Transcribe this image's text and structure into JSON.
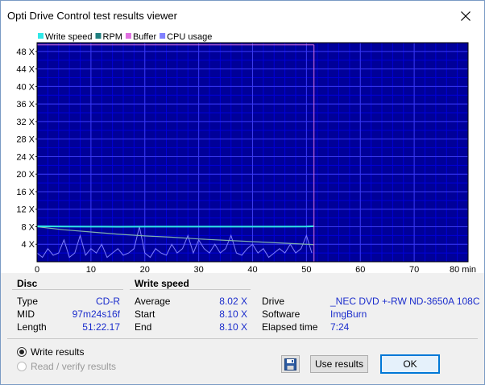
{
  "window": {
    "title": "Opti Drive Control test results viewer"
  },
  "colors": {
    "plot_bg": "#000099",
    "grid": "#0000d8",
    "write_speed": "#30e8e8",
    "rpm": "#208080",
    "buffer": "#e070e0",
    "cpu_usage": "#8080ff"
  },
  "chart_data": {
    "type": "line",
    "legend": [
      "Write speed",
      "RPM",
      "Buffer",
      "CPU usage"
    ],
    "legend_position": "top-left",
    "x_ticks": [
      "0",
      "10",
      "20",
      "30",
      "40",
      "50",
      "60",
      "70",
      "80 min"
    ],
    "y_ticks": [
      "4 X",
      "8 X",
      "12 X",
      "16 X",
      "20 X",
      "24 X",
      "28 X",
      "32 X",
      "36 X",
      "40 X",
      "44 X",
      "48 X"
    ],
    "xlim": [
      0,
      80
    ],
    "ylim": [
      0,
      50
    ],
    "grid": true,
    "series": [
      {
        "name": "Write speed",
        "x": [
          0,
          5,
          10,
          15,
          20,
          25,
          30,
          35,
          40,
          45,
          50,
          51.4
        ],
        "y": [
          8.1,
          8.05,
          8.02,
          8.0,
          8.02,
          8.03,
          8.02,
          8.01,
          8.02,
          8.03,
          8.05,
          8.1
        ]
      },
      {
        "name": "RPM",
        "x": [
          0,
          5,
          10,
          15,
          20,
          25,
          30,
          35,
          40,
          45,
          50,
          51.4
        ],
        "y": [
          8.0,
          7.3,
          6.8,
          6.3,
          5.9,
          5.6,
          5.2,
          4.9,
          4.6,
          4.3,
          4.0,
          3.9
        ]
      },
      {
        "name": "Buffer",
        "x": [
          0,
          51.4
        ],
        "y": [
          49.5,
          49.5
        ]
      },
      {
        "name": "CPU usage",
        "x": [
          0,
          1,
          2,
          3,
          4,
          5,
          6,
          7,
          8,
          9,
          10,
          11,
          12,
          13,
          14,
          15,
          16,
          17,
          18,
          19,
          20,
          21,
          22,
          23,
          24,
          25,
          26,
          27,
          28,
          29,
          30,
          31,
          32,
          33,
          34,
          35,
          36,
          37,
          38,
          39,
          40,
          41,
          42,
          43,
          44,
          45,
          46,
          47,
          48,
          49,
          50,
          51
        ],
        "y": [
          2,
          1,
          3,
          1.5,
          2,
          5,
          1,
          2,
          6,
          1.5,
          3,
          2,
          4,
          1,
          2,
          3,
          1.5,
          2,
          3,
          8,
          2,
          1,
          3,
          2,
          1.5,
          4,
          2,
          3,
          6,
          2,
          5,
          3,
          2,
          4,
          2,
          3,
          6,
          2,
          1.5,
          3,
          4,
          2,
          3,
          1,
          2,
          3,
          2,
          4,
          2,
          3,
          6,
          2
        ]
      }
    ]
  },
  "disc": {
    "heading": "Disc",
    "type_label": "Type",
    "type_value": "CD-R",
    "mid_label": "MID",
    "mid_value": "97m24s16f",
    "length_label": "Length",
    "length_value": "51:22.17"
  },
  "write_speed": {
    "heading": "Write speed",
    "average_label": "Average",
    "average_value": "8.02 X",
    "start_label": "Start",
    "start_value": "8.10 X",
    "end_label": "End",
    "end_value": "8.10 X"
  },
  "drive_info": {
    "drive_label": "Drive",
    "drive_value": "_NEC DVD +-RW ND-3650A 108C",
    "software_label": "Software",
    "software_value": "ImgBurn",
    "elapsed_label": "Elapsed time",
    "elapsed_value": "7:24"
  },
  "mode": {
    "write_results_label": "Write results",
    "read_verify_label": "Read / verify results",
    "selected": "Write results"
  },
  "buttons": {
    "use_results": "Use results",
    "ok": "OK"
  }
}
